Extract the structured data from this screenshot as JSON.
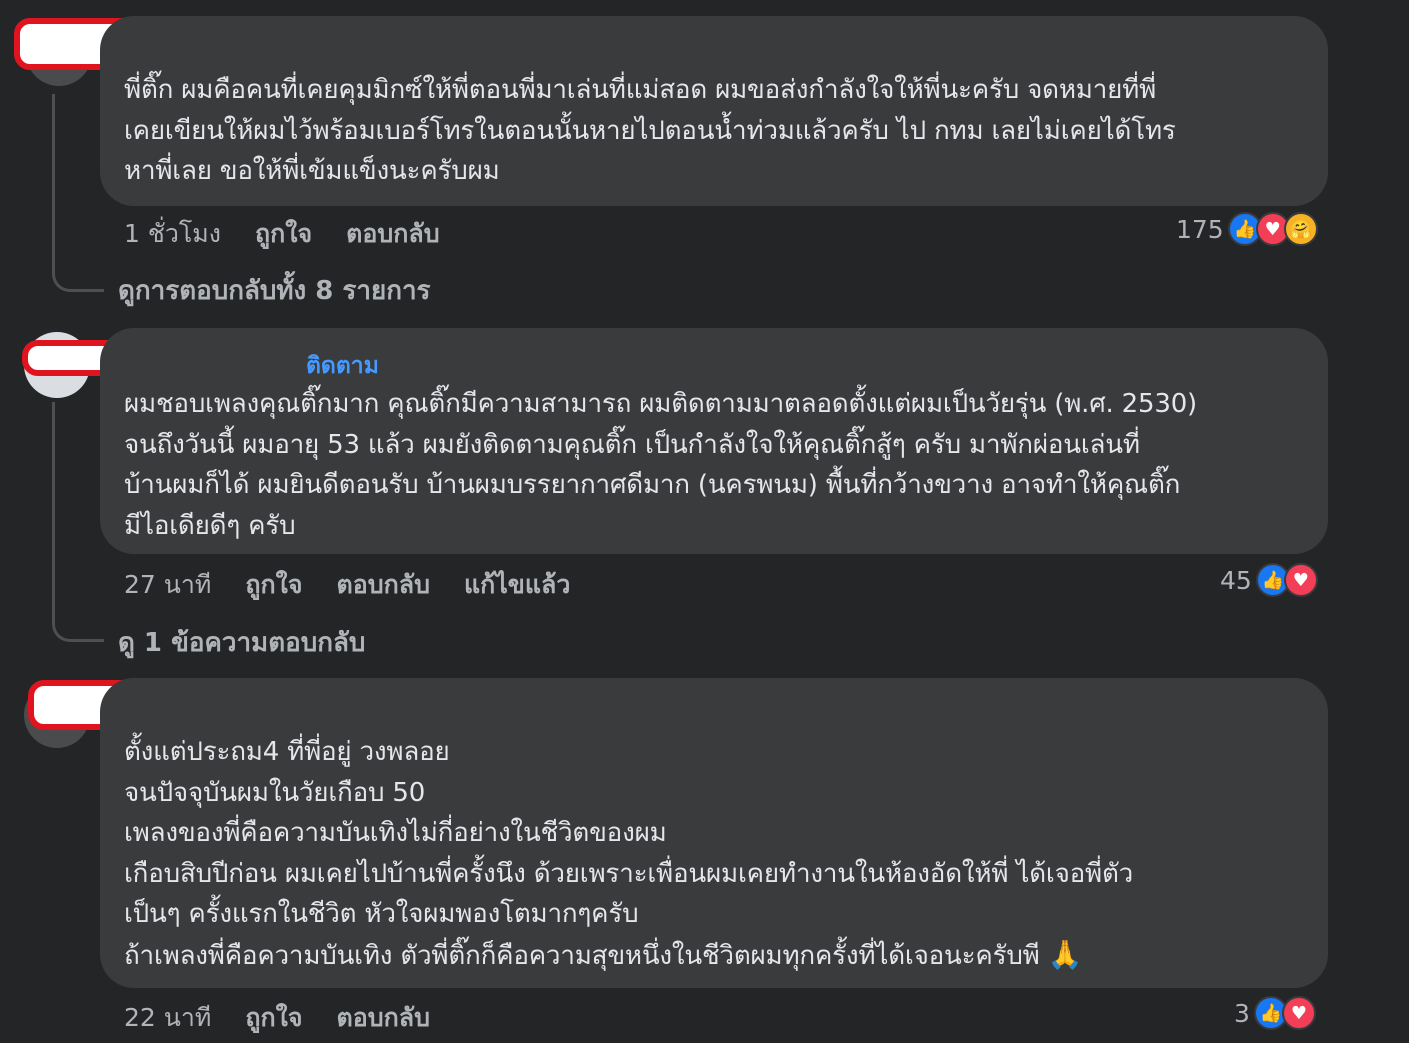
{
  "comments": [
    {
      "text": "พี่ติ๊ก ผมคือคนที่เคยคุมมิกซ์ให้พี่ตอนพี่มาเล่นที่แม่สอด ผมขอส่งกำลังใจให้พี่นะครับ จดหมายที่พี่\nเคยเขียนให้ผมไว้พร้อมเบอร์โทรในตอนนั้นหายไปตอนน้ำท่วมแล้วครับ ไป กทม เลยไม่เคยได้โทร\nหาพี่เลย ขอให้พี่เข้มแข็งนะครับผม",
      "time": "1 ชั่วโมง",
      "like": "ถูกใจ",
      "reply": "ตอบกลับ",
      "reaction_count": "175",
      "reactions": [
        "like-icon",
        "love-icon",
        "care-icon"
      ],
      "view_replies": "ดูการตอบกลับทั้ง 8 รายการ"
    },
    {
      "follow": "ติดตาม",
      "text": "ผมชอบเพลงคุณติ๊กมาก คุณติ๊กมีความสามารถ ผมติดตามมาตลอดตั้งแต่ผมเป็นวัยรุ่น (พ.ศ. 2530)\nจนถึงวันนี้ ผมอายุ 53 แล้ว ผมยังติดตามคุณติ๊ก เป็นกำลังใจให้คุณติ๊กสู้ๆ ครับ มาพักผ่อนเล่นที่\nบ้านผมก็ได้ ผมยินดีตอนรับ บ้านผมบรรยากาศดีมาก (นครพนม) พื้นที่กว้างขวาง อาจทำให้คุณติ๊ก\nมีไอเดียดีๆ ครับ",
      "time": "27 นาที",
      "like": "ถูกใจ",
      "reply": "ตอบกลับ",
      "edited": "แก้ไขแล้ว",
      "reaction_count": "45",
      "reactions": [
        "like-icon",
        "love-icon"
      ],
      "view_replies": "ดู 1 ข้อความตอบกลับ"
    },
    {
      "text": "ตั้งแต่ประถม4 ที่พี่อยู่ วงพลอย\nจนปัจจุบันผมในวัยเกือบ 50\nเพลงของพี่คือความบันเทิงไม่กี่อย่างในชีวิตของผม\nเกือบสิบปีก่อน ผมเคยไปบ้านพี่ครั้งนึง ด้วยเพราะเพื่อนผมเคยทำงานในห้องอัดให้พี่ ได้เจอพี่ตัว\nเป็นๆ ครั้งแรกในชีวิต หัวใจผมพองโตมากๆครับ\nถ้าเพลงพี่คือความบันเทิง ตัวพี่ติ๊กก็คือความสุขหนึ่งในชีวิตผมทุกครั้งที่ได้เจอนะครับพี",
      "pray_emoji": "🙏",
      "time": "22 นาที",
      "like": "ถูกใจ",
      "reply": "ตอบกลับ",
      "reaction_count": "3",
      "reactions": [
        "like-icon",
        "love-icon"
      ]
    }
  ],
  "colors": {
    "background": "#242526",
    "bubble": "#3a3b3c",
    "text": "#e4e6eb",
    "secondary": "#b0b3b8",
    "link": "#4599ff",
    "redaction_border": "#e0141e"
  }
}
